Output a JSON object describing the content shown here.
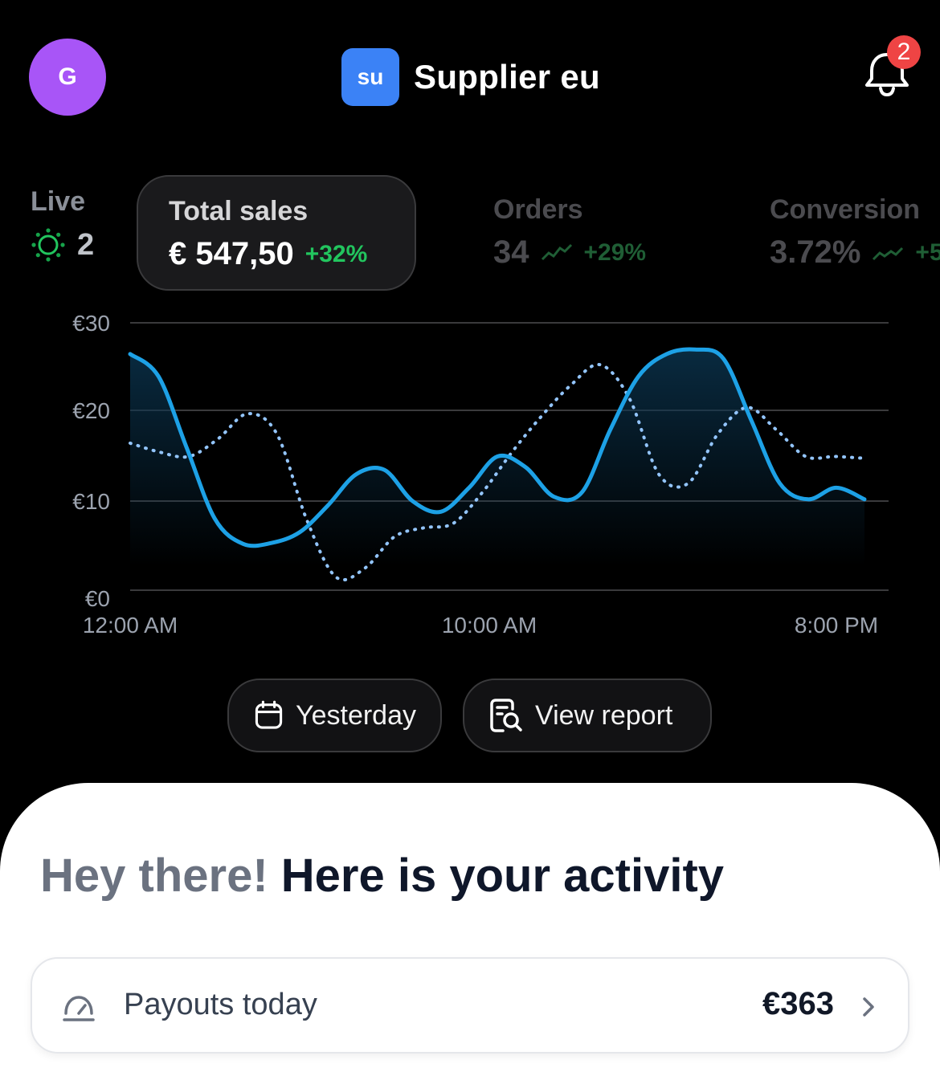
{
  "header": {
    "avatar_initial": "G",
    "store_badge": "su",
    "store_name": "Supplier eu",
    "notification_count": "2"
  },
  "live": {
    "label": "Live",
    "count": "2"
  },
  "metrics": [
    {
      "label": "Total sales",
      "value": "€ 547,50",
      "delta": "+32%",
      "selected": true
    },
    {
      "label": "Orders",
      "value": "34",
      "delta": "+29%",
      "selected": false
    },
    {
      "label": "Conversion",
      "value": "3.72%",
      "delta": "+5",
      "selected": false
    }
  ],
  "chart_data": {
    "type": "line",
    "y_ticks": [
      "€30",
      "€20",
      "€10",
      "€0"
    ],
    "x_ticks": [
      "12:00 AM",
      "10:00 AM",
      "8:00 PM"
    ],
    "ylim": [
      0,
      30
    ],
    "series": [
      {
        "style": "solid",
        "color": "#1da1e6",
        "values": [
          26.5,
          24,
          16,
          8,
          5.2,
          5.3,
          6.5,
          9.5,
          13,
          13.5,
          10,
          8.8,
          11.5,
          15,
          13.8,
          10.5,
          11,
          18,
          24,
          26.5,
          27,
          26,
          19,
          12,
          10.2,
          11.5,
          10.2
        ]
      },
      {
        "style": "dotted",
        "color": "#93c5fd",
        "values": [
          16.5,
          15.5,
          15,
          17,
          19.8,
          17.5,
          8,
          1.5,
          2.5,
          6,
          7,
          7.5,
          11,
          15.5,
          19.5,
          23,
          25.3,
          21.5,
          13,
          12,
          17.5,
          20.5,
          18,
          15,
          15,
          14.8
        ]
      }
    ]
  },
  "actions": {
    "yesterday": "Yesterday",
    "view_report": "View report"
  },
  "activity": {
    "greeting_muted": "Hey there!",
    "greeting_strong": "Here is your activity",
    "payout_label": "Payouts today",
    "payout_amount": "€363"
  }
}
